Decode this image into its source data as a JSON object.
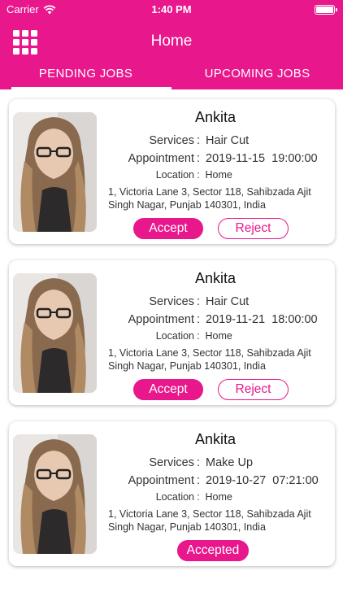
{
  "status_bar": {
    "carrier": "Carrier",
    "time": "1:40 PM"
  },
  "header": {
    "title": "Home",
    "menu_icon": "grid-menu-icon"
  },
  "tabs": [
    {
      "label": "PENDING JOBS",
      "active": true
    },
    {
      "label": "UPCOMING JOBS",
      "active": false
    }
  ],
  "colors": {
    "accent": "#e8178c"
  },
  "labels": {
    "services": "Services",
    "appointment": "Appointment",
    "location": "Location",
    "separator": ":"
  },
  "jobs": [
    {
      "name": "Ankita",
      "services": "Hair Cut",
      "appointment": "2019-11-15  19:00:00",
      "location": "Home",
      "address": "1, Victoria Lane 3, Sector 118, Sahibzada Ajit Singh Nagar, Punjab 140301, India",
      "accept_label": "Accept",
      "reject_label": "Reject"
    },
    {
      "name": "Ankita",
      "services": "Hair Cut",
      "appointment": "2019-11-21  18:00:00",
      "location": "Home",
      "address": "1, Victoria Lane 3, Sector 118, Sahibzada Ajit Singh Nagar, Punjab 140301, India",
      "accept_label": "Accept",
      "reject_label": "Reject"
    },
    {
      "name": "Ankita",
      "services": "Make Up",
      "appointment": "2019-10-27  07:21:00",
      "location": "Home",
      "address": "1, Victoria Lane 3, Sector 118, Sahibzada Ajit Singh Nagar, Punjab 140301, India",
      "accepted_label": "Accepted"
    }
  ]
}
